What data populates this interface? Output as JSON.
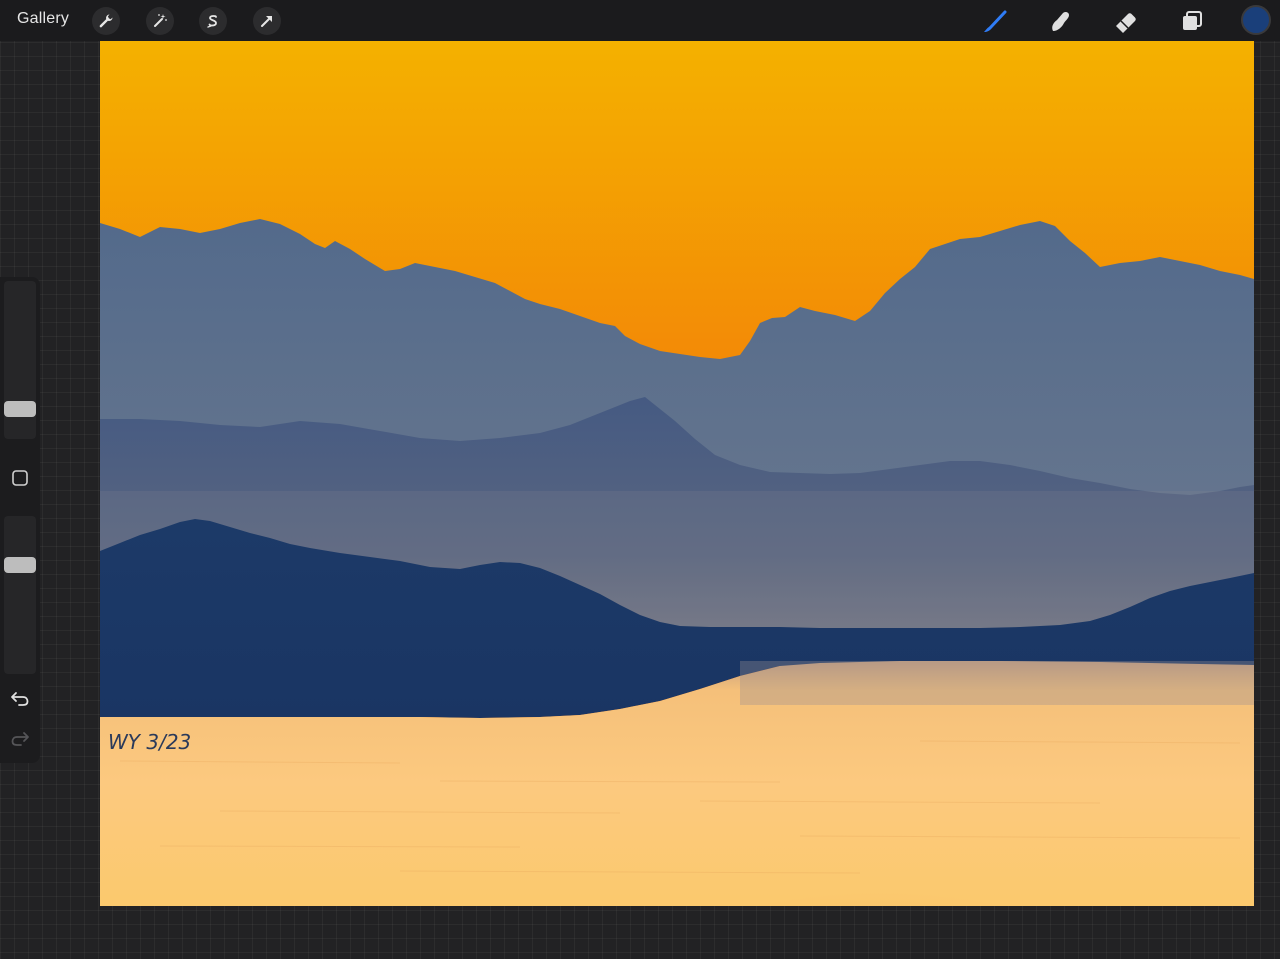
{
  "app": {
    "gallery_label": "Gallery"
  },
  "toolbar": {
    "left_tools": [
      "actions",
      "adjustments",
      "selection",
      "transform"
    ],
    "right_tools": [
      "brush",
      "smudge",
      "eraser",
      "layers"
    ],
    "active_tool": "brush",
    "accent_color": "#2f7cf6",
    "current_color": "#1a3f7a"
  },
  "sidebar": {
    "controls": [
      "brush-size-slider",
      "modify-button",
      "opacity-slider",
      "undo",
      "redo"
    ]
  },
  "canvas": {
    "signature_text": "WY 3/23",
    "colors": {
      "sky_top": "#f3b200",
      "sky_mid": "#f38a05",
      "sky_low": "#ee6a04",
      "far_mountains": "#586d8e",
      "mid_mountains": "#4b5f85",
      "near_mountains": "#1e3d6c",
      "water_light": "#fcc97a",
      "water_dark": "#f6b65f"
    }
  }
}
